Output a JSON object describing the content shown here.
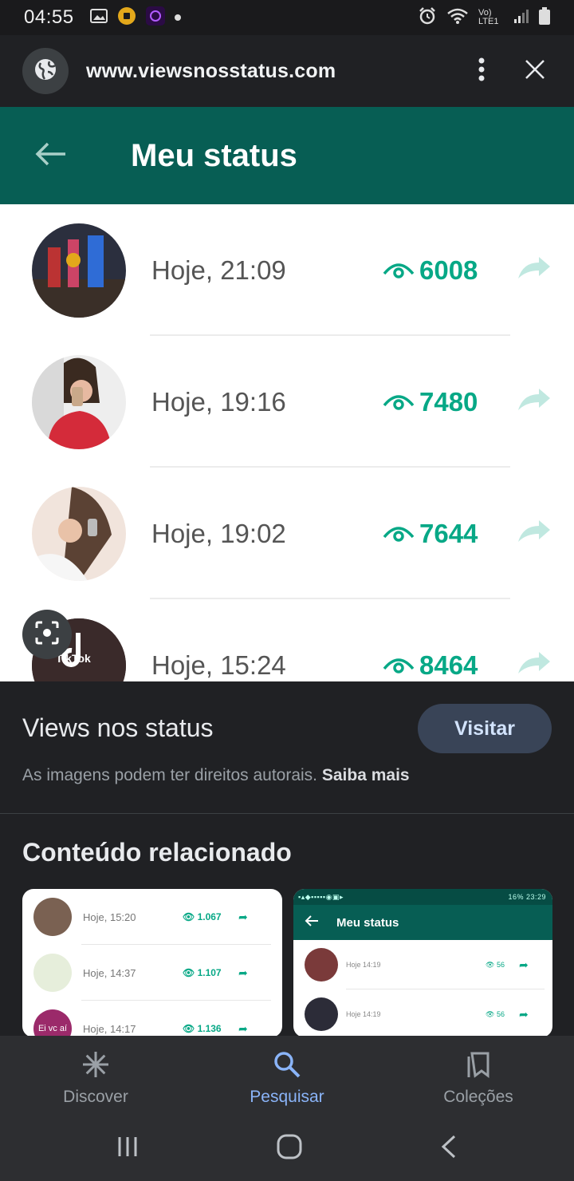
{
  "status_bar": {
    "time": "04:55",
    "network": "Vo) LTE1",
    "icons": [
      "gallery-icon",
      "yellow-app-icon",
      "purple-app-icon",
      "notification-dot-icon",
      "alarm-icon",
      "wifi-icon",
      "signal-icon",
      "battery-icon"
    ]
  },
  "browser": {
    "url": "www.viewsnosstatus.com",
    "icons": [
      "globe-icon",
      "more-vert-icon",
      "close-icon"
    ]
  },
  "preview": {
    "header_title": "Meu status",
    "rows": [
      {
        "time": "Hoje, 21:09",
        "views": "6008"
      },
      {
        "time": "Hoje, 19:16",
        "views": "7480"
      },
      {
        "time": "Hoje, 19:02",
        "views": "7644"
      },
      {
        "time": "Hoje, 15:24",
        "views": "8464"
      }
    ],
    "avatar_text": "TikTok"
  },
  "info": {
    "title": "Views nos status",
    "visit_label": "Visitar",
    "copyright_text": "As imagens podem ter direitos autorais.",
    "learn_more": "Saiba mais"
  },
  "related": {
    "title": "Conteúdo relacionado",
    "thumb1_rows": [
      {
        "time": "Hoje, 15:20",
        "views": "1.067"
      },
      {
        "time": "Hoje, 14:37",
        "views": "1.107"
      },
      {
        "time": "Hoje, 14:17",
        "views": "1.136",
        "avatar_text": "Ei vc aí"
      }
    ],
    "thumb2": {
      "status_text": "16% 23:29",
      "header_title": "Meu status",
      "rows": [
        {
          "time": "Hoje 14:19",
          "views": "56"
        },
        {
          "time": "Hoje 14:19",
          "views": "56"
        }
      ]
    }
  },
  "bottom_nav": [
    {
      "label": "Discover",
      "icon": "discover-icon"
    },
    {
      "label": "Pesquisar",
      "icon": "search-icon"
    },
    {
      "label": "Coleções",
      "icon": "collections-icon"
    }
  ],
  "colors": {
    "whatsapp_green": "#075e54",
    "views_green": "#07a886",
    "accent_blue": "#8ab4f8",
    "dark_bg": "#202124"
  }
}
